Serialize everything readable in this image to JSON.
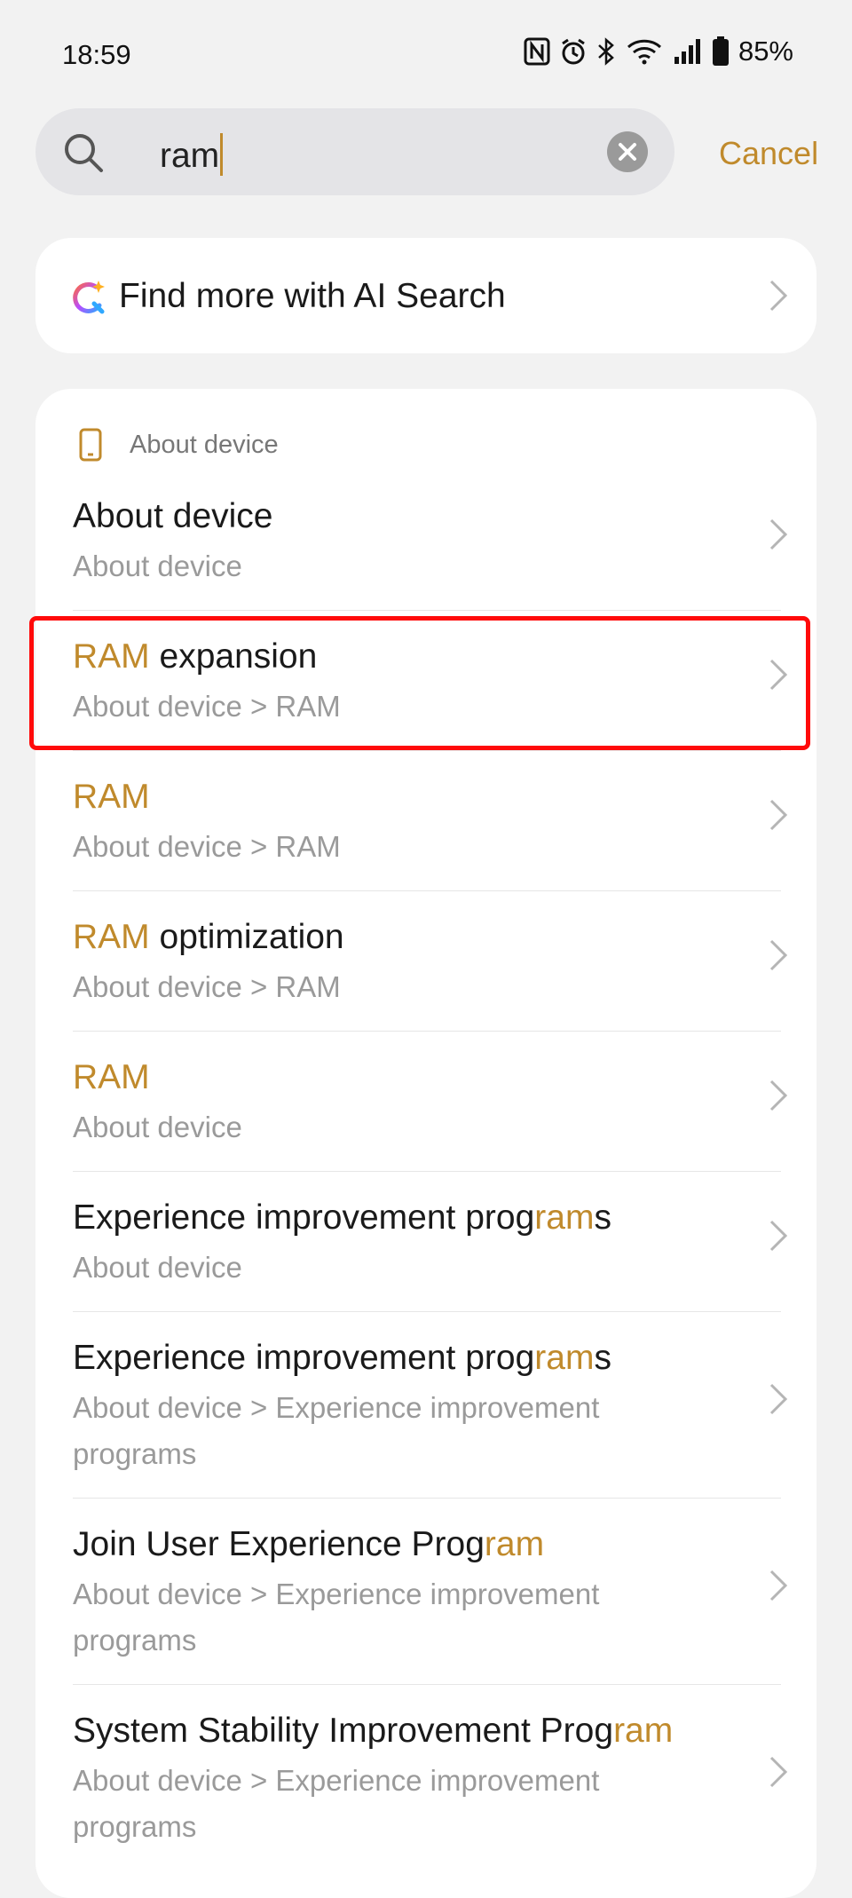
{
  "status_bar": {
    "time": "18:59",
    "battery": "85%",
    "icons": [
      "nfc-icon",
      "alarm-icon",
      "bluetooth-icon",
      "wifi-icon",
      "signal-icon",
      "battery-icon"
    ]
  },
  "search": {
    "value": "ram",
    "cancel_label": "Cancel"
  },
  "ai_search": {
    "label": "Find more with AI Search"
  },
  "results": {
    "section_title": "About device",
    "items": [
      {
        "title_hl": "",
        "title_rest": "About device",
        "subtitle": "About device"
      },
      {
        "title_hl": "RAM",
        "title_rest": " expansion",
        "subtitle": "About device > RAM",
        "highlighted": true
      },
      {
        "title_hl": "RAM",
        "title_rest": "",
        "subtitle": "About device > RAM"
      },
      {
        "title_hl": "RAM",
        "title_rest": " optimization",
        "subtitle": "About device > RAM"
      },
      {
        "title_hl": "RAM",
        "title_rest": "",
        "subtitle": "About device"
      },
      {
        "title_pre": "Experience improvement prog",
        "title_hl": "ram",
        "title_post": "s",
        "subtitle": "About device"
      },
      {
        "title_pre": "Experience improvement prog",
        "title_hl": "ram",
        "title_post": "s",
        "subtitle_line1": "About device > Experience improvement",
        "subtitle_line2": "programs"
      },
      {
        "title_pre": "Join User Experience Prog",
        "title_hl": "ram",
        "title_post": "",
        "subtitle_line1": "About device > Experience improvement",
        "subtitle_line2": "programs"
      },
      {
        "title_pre": "System Stability Improvement Prog",
        "title_hl": "ram",
        "title_post": "",
        "subtitle_line1": "About device > Experience improvement",
        "subtitle_line2": "programs"
      }
    ]
  },
  "colors": {
    "accent": "#c08a2c",
    "background": "#f2f2f2",
    "card": "#ffffff",
    "highlight_border": "#ff0a0a"
  }
}
